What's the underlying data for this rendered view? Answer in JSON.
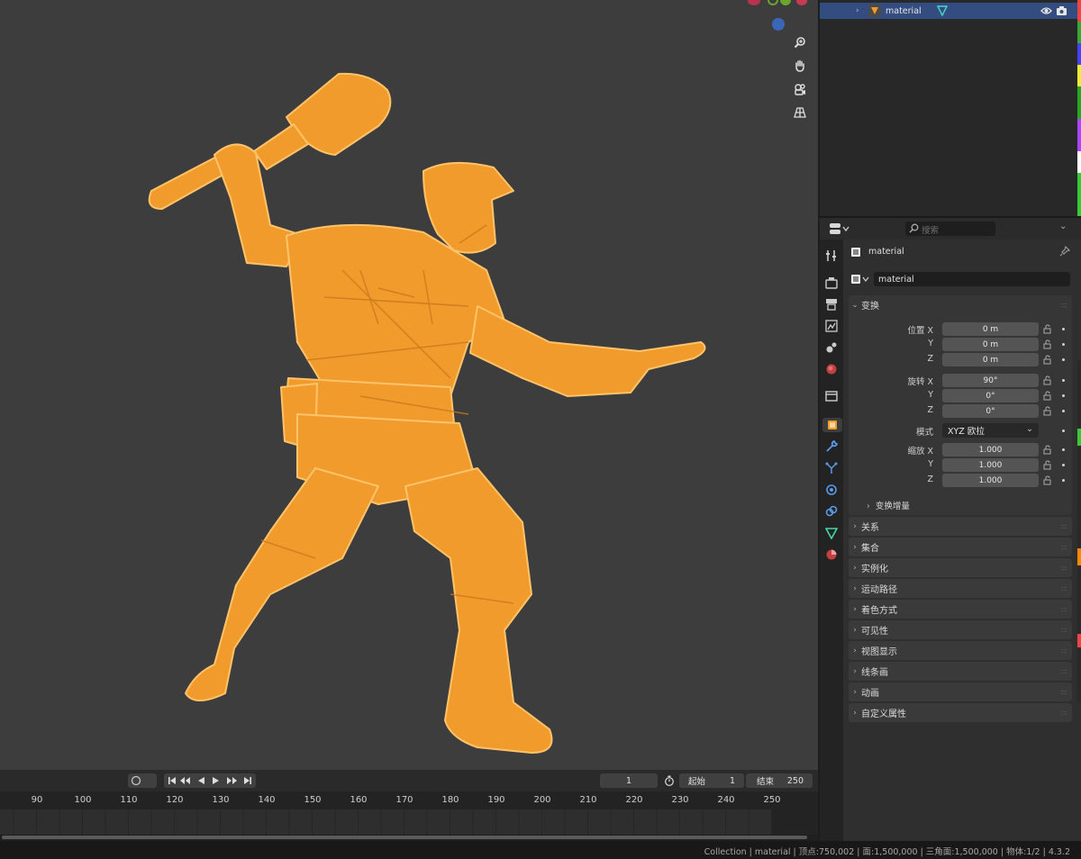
{
  "outliner": {
    "selected_item": {
      "label": "material"
    }
  },
  "properties": {
    "search_placeholder": "搜索",
    "object_name_header": "material",
    "object_name_field": "material",
    "transform": {
      "title": "变换",
      "location": {
        "label": "位置",
        "x_axis": "X",
        "y_axis": "Y",
        "z_axis": "Z",
        "x": "0 m",
        "y": "0 m",
        "z": "0 m"
      },
      "rotation": {
        "label": "旋转",
        "x_axis": "X",
        "y_axis": "Y",
        "z_axis": "Z",
        "x": "90°",
        "y": "0°",
        "z": "0°"
      },
      "mode": {
        "label": "模式",
        "value": "XYZ 欧拉"
      },
      "scale": {
        "label": "缩放",
        "x_axis": "X",
        "y_axis": "Y",
        "z_axis": "Z",
        "x": "1.000",
        "y": "1.000",
        "z": "1.000"
      },
      "delta_subpanel": "变换增量"
    },
    "panels": [
      "关系",
      "集合",
      "实例化",
      "运动路径",
      "着色方式",
      "可见性",
      "视图显示",
      "线条画",
      "动画",
      "自定义属性"
    ]
  },
  "timeline": {
    "current_frame": "1",
    "start_label": "起始",
    "start_value": "1",
    "end_label": "结束",
    "end_value": "250",
    "ruler": [
      "90",
      "100",
      "110",
      "120",
      "130",
      "140",
      "150",
      "160",
      "170",
      "180",
      "190",
      "200",
      "210",
      "220",
      "230",
      "240",
      "250"
    ]
  },
  "statusbar": {
    "text": "Collection | material | 顶点:750,002 | 面:1,500,000 | 三角面:1,500,000 | 物体:1/2 | 4.3.2"
  },
  "colors": {
    "selection_orange": "#f19b2c",
    "viewport_bg": "#3d3d3d",
    "outliner_highlight": "#334d80"
  }
}
